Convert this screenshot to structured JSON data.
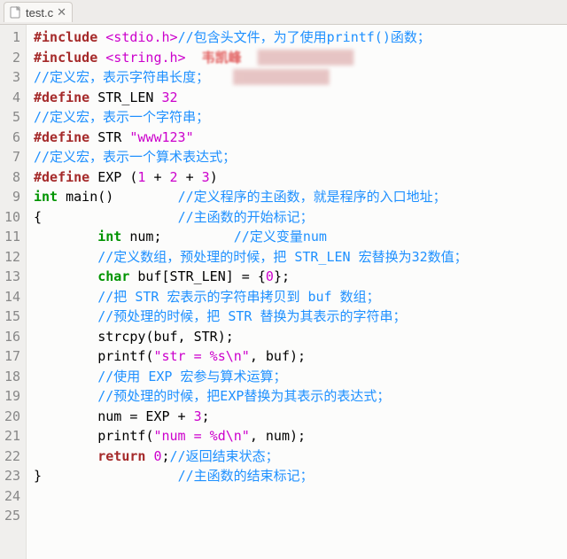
{
  "tab": {
    "filename": "test.c"
  },
  "lines": [
    {
      "n": 1,
      "segs": [
        [
          "kw-pre",
          "#include "
        ],
        [
          "str",
          "<stdio.h>"
        ],
        [
          "cmt",
          "//包含头文件，为了使用printf()函数；"
        ]
      ]
    },
    {
      "n": 2,
      "segs": [
        [
          "kw-pre",
          "#include "
        ],
        [
          "str",
          "<string.h>"
        ],
        [
          "watermark",
          "  韦凯峰  "
        ],
        [
          "smudge",
          "████████████"
        ]
      ]
    },
    {
      "n": 3,
      "segs": [
        [
          "cmt",
          "//定义宏，表示字符串长度；"
        ],
        [
          "smudge",
          "   ████████████"
        ]
      ]
    },
    {
      "n": 4,
      "segs": [
        [
          "kw-pre",
          "#define "
        ],
        [
          "ident",
          "STR_LEN "
        ],
        [
          "num",
          "32"
        ]
      ]
    },
    {
      "n": 5,
      "segs": [
        [
          "cmt",
          "//定义宏，表示一个字符串；"
        ]
      ]
    },
    {
      "n": 6,
      "segs": [
        [
          "kw-pre",
          "#define "
        ],
        [
          "ident",
          "STR "
        ],
        [
          "str",
          "\"www123\""
        ]
      ]
    },
    {
      "n": 7,
      "segs": [
        [
          "cmt",
          "//定义宏，表示一个算术表达式；"
        ]
      ]
    },
    {
      "n": 8,
      "segs": [
        [
          "kw-pre",
          "#define "
        ],
        [
          "ident",
          "EXP "
        ],
        [
          "op",
          "("
        ],
        [
          "num",
          "1"
        ],
        [
          "op",
          " + "
        ],
        [
          "num",
          "2"
        ],
        [
          "op",
          " + "
        ],
        [
          "num",
          "3"
        ],
        [
          "op",
          ")"
        ]
      ]
    },
    {
      "n": 9,
      "segs": [
        [
          "ident",
          ""
        ]
      ]
    },
    {
      "n": 10,
      "segs": [
        [
          "type",
          "int "
        ],
        [
          "fn",
          "main"
        ],
        [
          "op",
          "()        "
        ],
        [
          "cmt",
          "//定义程序的主函数，就是程序的入口地址；"
        ]
      ]
    },
    {
      "n": 11,
      "segs": [
        [
          "op",
          "{                 "
        ],
        [
          "cmt",
          "//主函数的开始标记；"
        ]
      ]
    },
    {
      "n": 12,
      "segs": [
        [
          "ident",
          "        "
        ],
        [
          "type",
          "int "
        ],
        [
          "ident",
          "num;         "
        ],
        [
          "cmt",
          "//定义变量num"
        ]
      ]
    },
    {
      "n": 13,
      "segs": [
        [
          "ident",
          "        "
        ],
        [
          "cmt",
          "//定义数组，预处理的时候，把 STR_LEN 宏替换为32数值；"
        ]
      ]
    },
    {
      "n": 14,
      "segs": [
        [
          "ident",
          "        "
        ],
        [
          "type",
          "char "
        ],
        [
          "ident",
          "buf[STR_LEN] = {"
        ],
        [
          "num",
          "0"
        ],
        [
          "ident",
          "};"
        ]
      ]
    },
    {
      "n": 15,
      "segs": [
        [
          "ident",
          "        "
        ],
        [
          "cmt",
          "//把 STR 宏表示的字符串拷贝到 buf 数组；"
        ]
      ]
    },
    {
      "n": 16,
      "segs": [
        [
          "ident",
          "        "
        ],
        [
          "cmt",
          "//预处理的时候，把 STR 替换为其表示的字符串；"
        ]
      ]
    },
    {
      "n": 17,
      "segs": [
        [
          "ident",
          "        "
        ],
        [
          "fn",
          "strcpy"
        ],
        [
          "op",
          "(buf, STR);"
        ]
      ]
    },
    {
      "n": 18,
      "segs": [
        [
          "ident",
          "        "
        ],
        [
          "fn",
          "printf"
        ],
        [
          "op",
          "("
        ],
        [
          "str",
          "\"str = %s\\n\""
        ],
        [
          "op",
          ", buf);"
        ]
      ]
    },
    {
      "n": 19,
      "segs": [
        [
          "ident",
          "        "
        ],
        [
          "cmt",
          "//使用 EXP 宏参与算术运算；"
        ]
      ]
    },
    {
      "n": 20,
      "segs": [
        [
          "ident",
          "        "
        ],
        [
          "cmt",
          "//预处理的时候，把EXP替换为其表示的表达式；"
        ]
      ]
    },
    {
      "n": 21,
      "segs": [
        [
          "ident",
          "        num = EXP + "
        ],
        [
          "num",
          "3"
        ],
        [
          "ident",
          ";"
        ]
      ]
    },
    {
      "n": 22,
      "segs": [
        [
          "ident",
          "        "
        ],
        [
          "fn",
          "printf"
        ],
        [
          "op",
          "("
        ],
        [
          "str",
          "\"num = %d\\n\""
        ],
        [
          "op",
          ", num);"
        ]
      ]
    },
    {
      "n": 23,
      "segs": [
        [
          "ident",
          ""
        ]
      ]
    },
    {
      "n": 24,
      "segs": [
        [
          "ident",
          "        "
        ],
        [
          "ret",
          "return "
        ],
        [
          "num",
          "0"
        ],
        [
          "ident",
          ";"
        ],
        [
          "cmt",
          "//返回结束状态；"
        ]
      ]
    },
    {
      "n": 25,
      "segs": [
        [
          "op",
          "}                 "
        ],
        [
          "cmt",
          "//主函数的结束标记；"
        ]
      ]
    }
  ]
}
